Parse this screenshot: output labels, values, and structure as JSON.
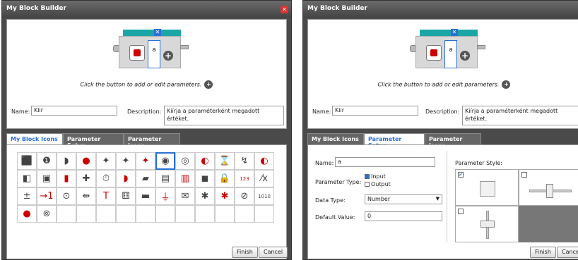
{
  "left": {
    "title": "My Block Builder",
    "hint": "Click the button to add or edit parameters.",
    "param_letter": "a",
    "name_label": "Name:",
    "name_value": "Kiir",
    "desc_label": "Description:",
    "desc_value": "Kiírja a paraméterként megadott értéket.",
    "tabs": [
      "My Block Icons",
      "Parameter Setup",
      "Parameter Icons"
    ],
    "active_tab": 0,
    "icons": [
      "⬛",
      "❶",
      "◗",
      "●",
      "✦",
      "✦",
      "✦",
      "◉",
      "◎",
      "◐",
      "⌛",
      "↯",
      "◐",
      "◧",
      "▣",
      "▮",
      "✚",
      "⏱",
      "◗",
      "▰",
      "▤",
      "▥",
      "◼",
      "🔒",
      "123",
      "⁄x",
      "±",
      "→1",
      "⊙",
      "⇹",
      "T",
      "⚅",
      "▬",
      "⏚",
      "✉",
      "✱",
      "✱",
      "⊘",
      "1010",
      "●",
      "⊚"
    ],
    "finish": "Finish",
    "cancel": "Cancel"
  },
  "right": {
    "title": "My Block Builder",
    "hint": "Click the button to add or edit parameters.",
    "param_letter": "a",
    "name_label": "Name:",
    "name_value": "Kiir",
    "desc_label": "Description:",
    "desc_value": "Kiírja a paraméterként megadott értéket.",
    "tabs": [
      "My Block Icons",
      "Parameter Setup",
      "Parameter Icons"
    ],
    "active_tab": 1,
    "pname_label": "Name:",
    "pname_value": "a",
    "ptype_label": "Parameter Type:",
    "ptype_input": "Input",
    "ptype_output": "Output",
    "dtype_label": "Data Type:",
    "dtype_value": "Number",
    "default_label": "Default Value:",
    "default_value": "0",
    "style_label": "Parameter Style:",
    "finish": "Finish",
    "cancel": "Cancel"
  }
}
